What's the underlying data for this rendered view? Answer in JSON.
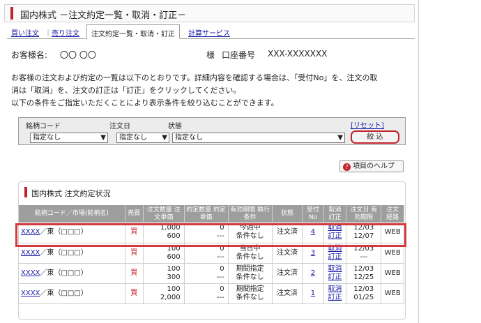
{
  "header": {
    "title": "国内株式 －注文約定一覧・取消・訂正－"
  },
  "tabs": [
    {
      "label": "買い注文"
    },
    {
      "label": "売り注文"
    },
    {
      "label": "注文約定一覧・取消・訂正"
    },
    {
      "label": "計算サービス"
    }
  ],
  "tab_sep": "｜",
  "customer": {
    "name_label": "お客様名:",
    "name_value": "〇〇 〇〇",
    "suffix": "様",
    "account_label": "口座番号",
    "account_value": "XXX-XXXXXXX"
  },
  "description": {
    "line1": "お客様の注文および約定の一覧は以下のとおりです。詳細内容を確認する場合は、「受付No」を、注文の取",
    "line2": "消は「取消」を、注文の訂正は「訂正」をクリックしてください。",
    "line3": "以下の条件をご指定いただくことにより表示条件を絞り込むことができます。"
  },
  "filter": {
    "code_label": "銘柄コード",
    "code_value": "指定なし",
    "date_label": "注文日",
    "date_value": "指定なし",
    "state_label": "状態",
    "state_value": "指定なし",
    "reset_label": "[リセット]",
    "narrow_label": "絞 込",
    "arrow": "▼"
  },
  "help": {
    "icon": "?",
    "label": "項目のヘルプ"
  },
  "panel": {
    "title": "国内株式 注文約定状況"
  },
  "table": {
    "headers": [
      "銘柄コード／市場(銘柄名)",
      "売買",
      "注文数量 注文単価",
      "約定数量 約定単価",
      "有効期間 執行条件",
      "状態",
      "受付 No",
      "取消 訂正",
      "注文日 有効期限",
      "注文 経路"
    ],
    "rows": [
      {
        "code": "XXXX",
        "market": "／東（□□□）",
        "side": "買",
        "qty": "1,000",
        "price": "600",
        "eqty": "0",
        "eprice": "---",
        "term": "今週中",
        "cond": "条件なし",
        "state": "注文済",
        "no": "4",
        "cancel": "取消",
        "amend": "訂正",
        "date": "12/03",
        "expiry": "12/07",
        "route": "WEB"
      },
      {
        "code": "XXXX",
        "market": "／東（□□□）",
        "side": "買",
        "qty": "100",
        "price": "600",
        "eqty": "0",
        "eprice": "---",
        "term": "当日中",
        "cond": "条件なし",
        "state": "注文済",
        "no": "3",
        "cancel": "取消",
        "amend": "訂正",
        "date": "12/03",
        "expiry": "---",
        "route": "WEB"
      },
      {
        "code": "XXXX",
        "market": "／東（□□□）",
        "side": "買",
        "qty": "100",
        "price": "300",
        "eqty": "0",
        "eprice": "---",
        "term": "期間指定",
        "cond": "条件なし",
        "state": "注文済",
        "no": "2",
        "cancel": "取消",
        "amend": "訂正",
        "date": "12/03",
        "expiry": "12/25",
        "route": "WEB"
      },
      {
        "code": "XXXX",
        "market": "／東（□□□）",
        "side": "買",
        "qty": "100",
        "price": "2,000",
        "eqty": "0",
        "eprice": "---",
        "term": "期間指定",
        "cond": "条件なし",
        "state": "注文済",
        "no": "1",
        "cancel": "取消",
        "amend": "訂正",
        "date": "12/03",
        "expiry": "01/25",
        "route": "WEB"
      }
    ]
  }
}
